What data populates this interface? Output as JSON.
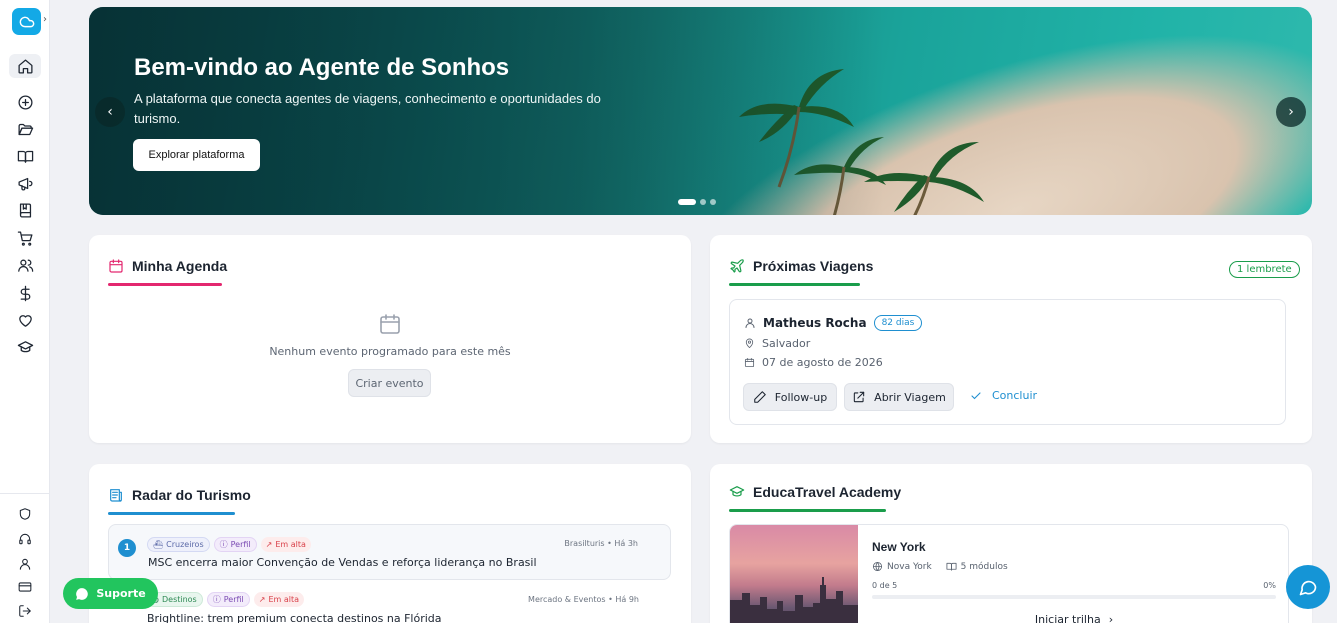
{
  "hero": {
    "title": "Bem-vindo ao Agente de Sonhos",
    "subtitle": "A plataforma que conecta agentes de viagens, conhecimento e oportunidades do turismo.",
    "cta": "Explorar plataforma",
    "prev_icon": "chevron-left-icon",
    "next_icon": "chevron-right-icon",
    "slide_count": 3,
    "active_slide": 1
  },
  "sidebar": {
    "expand_icon": "chevron-right-icon",
    "items": [
      {
        "icon": "home-icon",
        "active": true
      },
      {
        "icon": "plus-circle-icon"
      },
      {
        "icon": "folder-open-icon"
      },
      {
        "icon": "book-open-icon"
      },
      {
        "icon": "megaphone-icon"
      },
      {
        "icon": "notebook-icon"
      },
      {
        "icon": "cart-icon"
      },
      {
        "icon": "users-icon"
      },
      {
        "icon": "dollar-icon"
      },
      {
        "icon": "heart-icon"
      },
      {
        "icon": "graduation-cap-icon"
      }
    ],
    "bottom_items": [
      {
        "icon": "shield-icon"
      },
      {
        "icon": "headset-icon"
      },
      {
        "icon": "user-icon"
      },
      {
        "icon": "credit-card-icon"
      },
      {
        "icon": "logout-icon"
      }
    ]
  },
  "agenda": {
    "title": "Minha Agenda",
    "empty_text": "Nenhum evento programado para este mês",
    "create_button": "Criar evento",
    "accent": "#e3276f"
  },
  "trips": {
    "title": "Próximas Viagens",
    "badge": "1 lembrete",
    "accent": "#1a9d4b",
    "trip": {
      "name": "Matheus Rocha",
      "days_badge": "82 dias",
      "destination": "Salvador",
      "date": "07 de agosto de 2026",
      "follow_up": "Follow-up",
      "open_trip": "Abrir Viagem",
      "complete": "Concluir"
    }
  },
  "radar": {
    "title": "Radar do Turismo",
    "accent": "#1f8fd0",
    "news": [
      {
        "rank": "1",
        "tags": [
          "Cruzeiros",
          "Perfil",
          "Em alta"
        ],
        "source": "Brasilturis • Há 3h",
        "title": "MSC encerra maior Convenção de Vendas e reforça liderança no Brasil"
      },
      {
        "rank": "",
        "tags": [
          "Destinos",
          "Perfil",
          "Em alta"
        ],
        "source": "Mercado & Eventos • Há 9h",
        "title": "Brightline: trem premium conecta destinos na Flórida"
      }
    ]
  },
  "academy": {
    "title": "EducaTravel Academy",
    "accent": "#1a9d4b",
    "course": {
      "title": "New York",
      "location": "Nova York",
      "modules": "5 módulos",
      "progress_label": "0 de 5",
      "progress_percent": "0%",
      "progress_value": 0,
      "cta": "Iniciar trilha"
    }
  },
  "support": {
    "label": "Suporte"
  }
}
